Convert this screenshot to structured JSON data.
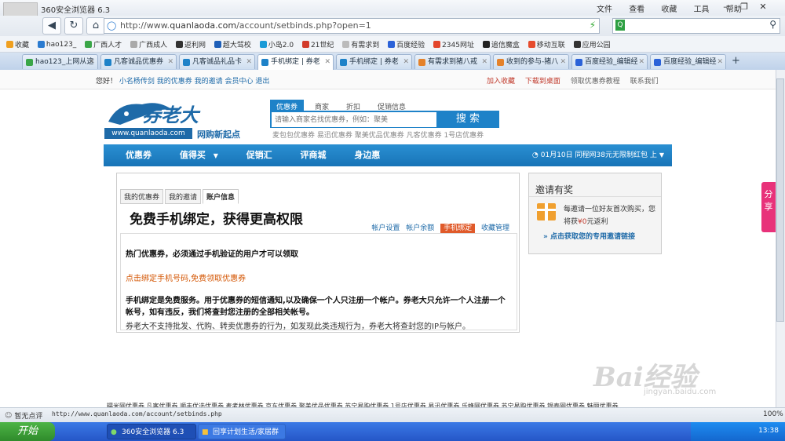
{
  "window": {
    "title": "360安全浏览器 6.3",
    "menus": [
      "文件",
      "查看",
      "收藏",
      "工具",
      "帮助"
    ]
  },
  "address_bar": {
    "url_prefix": "http://www.",
    "url_domain": "quanlaoda.com",
    "url_path": "/account/setbinds.php?open=1",
    "search_value": ""
  },
  "bookmarks": [
    "收藏",
    "hao123_",
    "广西人才",
    "广西成人",
    "返利网",
    "超大驾校",
    "小岛2.0",
    "21世纪",
    "有需求到",
    "百度经验",
    "2345网址",
    "追信魔盒",
    "移动互联",
    "应用公园"
  ],
  "tabs": [
    "hao123_上网从这",
    "凡客诚品优惠券",
    "凡客诚品礼品卡",
    "手机绑定 | 券老",
    "手机绑定 | 券老",
    "有需求到猪八戒",
    "收到的参与-猪八",
    "百度经验_编辑经",
    "百度经验_编辑经"
  ],
  "site": {
    "greeting": "您好！",
    "user_links": "小名杨传剑 我的优惠券 我的邀请 会员中心 退出",
    "right_links": [
      "加入收藏",
      "下载到桌面",
      "领取优惠券教程",
      "联系我们"
    ],
    "logo_text": "券老大",
    "logo_url": "www.quanlaoda.com",
    "slogan": "网购新起点",
    "search_tabs": [
      "优惠券",
      "商家",
      "折扣",
      "促销信息"
    ],
    "search_placeholder": "请输入商家名找优惠券，例如：聚美",
    "search_button": "搜 索",
    "hot_links": "麦包包优惠券 易迅优惠券 聚美优品优惠券 凡客优惠券 1号店优惠券",
    "nav": [
      "优惠券",
      "值得买",
      "促销汇",
      "评商城",
      "身边惠"
    ],
    "nav_notice": "01月10日 同程网38元无限制红包 上",
    "account_tabs": [
      "我的优惠券",
      "我的邀请",
      "账户信息"
    ],
    "heading": "免费手机绑定，获得更高权限",
    "subnav": [
      "帐户设置",
      "帐户余额",
      "手机绑定",
      "收藏管理"
    ],
    "body": {
      "line1": "热门优惠券，必须通过手机验证的用户才可以领取",
      "link": "点击绑定手机号码,免费领取优惠券",
      "line2": "手机绑定是免费服务。用于优惠券的短信通知,以及确保一个人只注册一个帐户。券老大只允许一个人注册一个帐号，如有违反，我们将查封您注册的全部相关帐号。",
      "line3": "券老大不支持批发、代购、转卖优惠券的行为，如发现此类违规行为，券老大将查封您的IP与帐户。"
    },
    "invite": {
      "title": "邀请有奖",
      "text1": "每邀请一位好友首次购买，您",
      "text2a": "将获",
      "text2b": "¥0",
      "text2c": "元返利",
      "link": "» 点击获取您的专用邀请链接"
    },
    "footer_links": "糯米网优惠券 凡客优惠券 顺丰优选优惠券 麦考林优惠券 京东优惠券 聚美优品优惠券 苏宁易购优惠券 1号店优惠券 易迅优惠券 乐蜂网优惠券 苏宁易购优惠券 银泰网优惠券 魅丽优惠券",
    "share": "分享"
  },
  "statusbar": {
    "left": "暂无点评",
    "url": "http://www.quanlaoda.com/account/setbinds.php",
    "zoom": "100%"
  },
  "taskbar": {
    "start": "开始",
    "tasks": [
      "360安全浏览器 6.3",
      "回享计划生活/家居群"
    ],
    "clock": "13:38"
  },
  "watermark": {
    "text": "Bai经验",
    "sub": "jingyan.baidu.com"
  },
  "colors": {
    "brand_blue": "#1e82c8",
    "accent_red": "#c0392b",
    "active_orange": "#e05a2a"
  }
}
